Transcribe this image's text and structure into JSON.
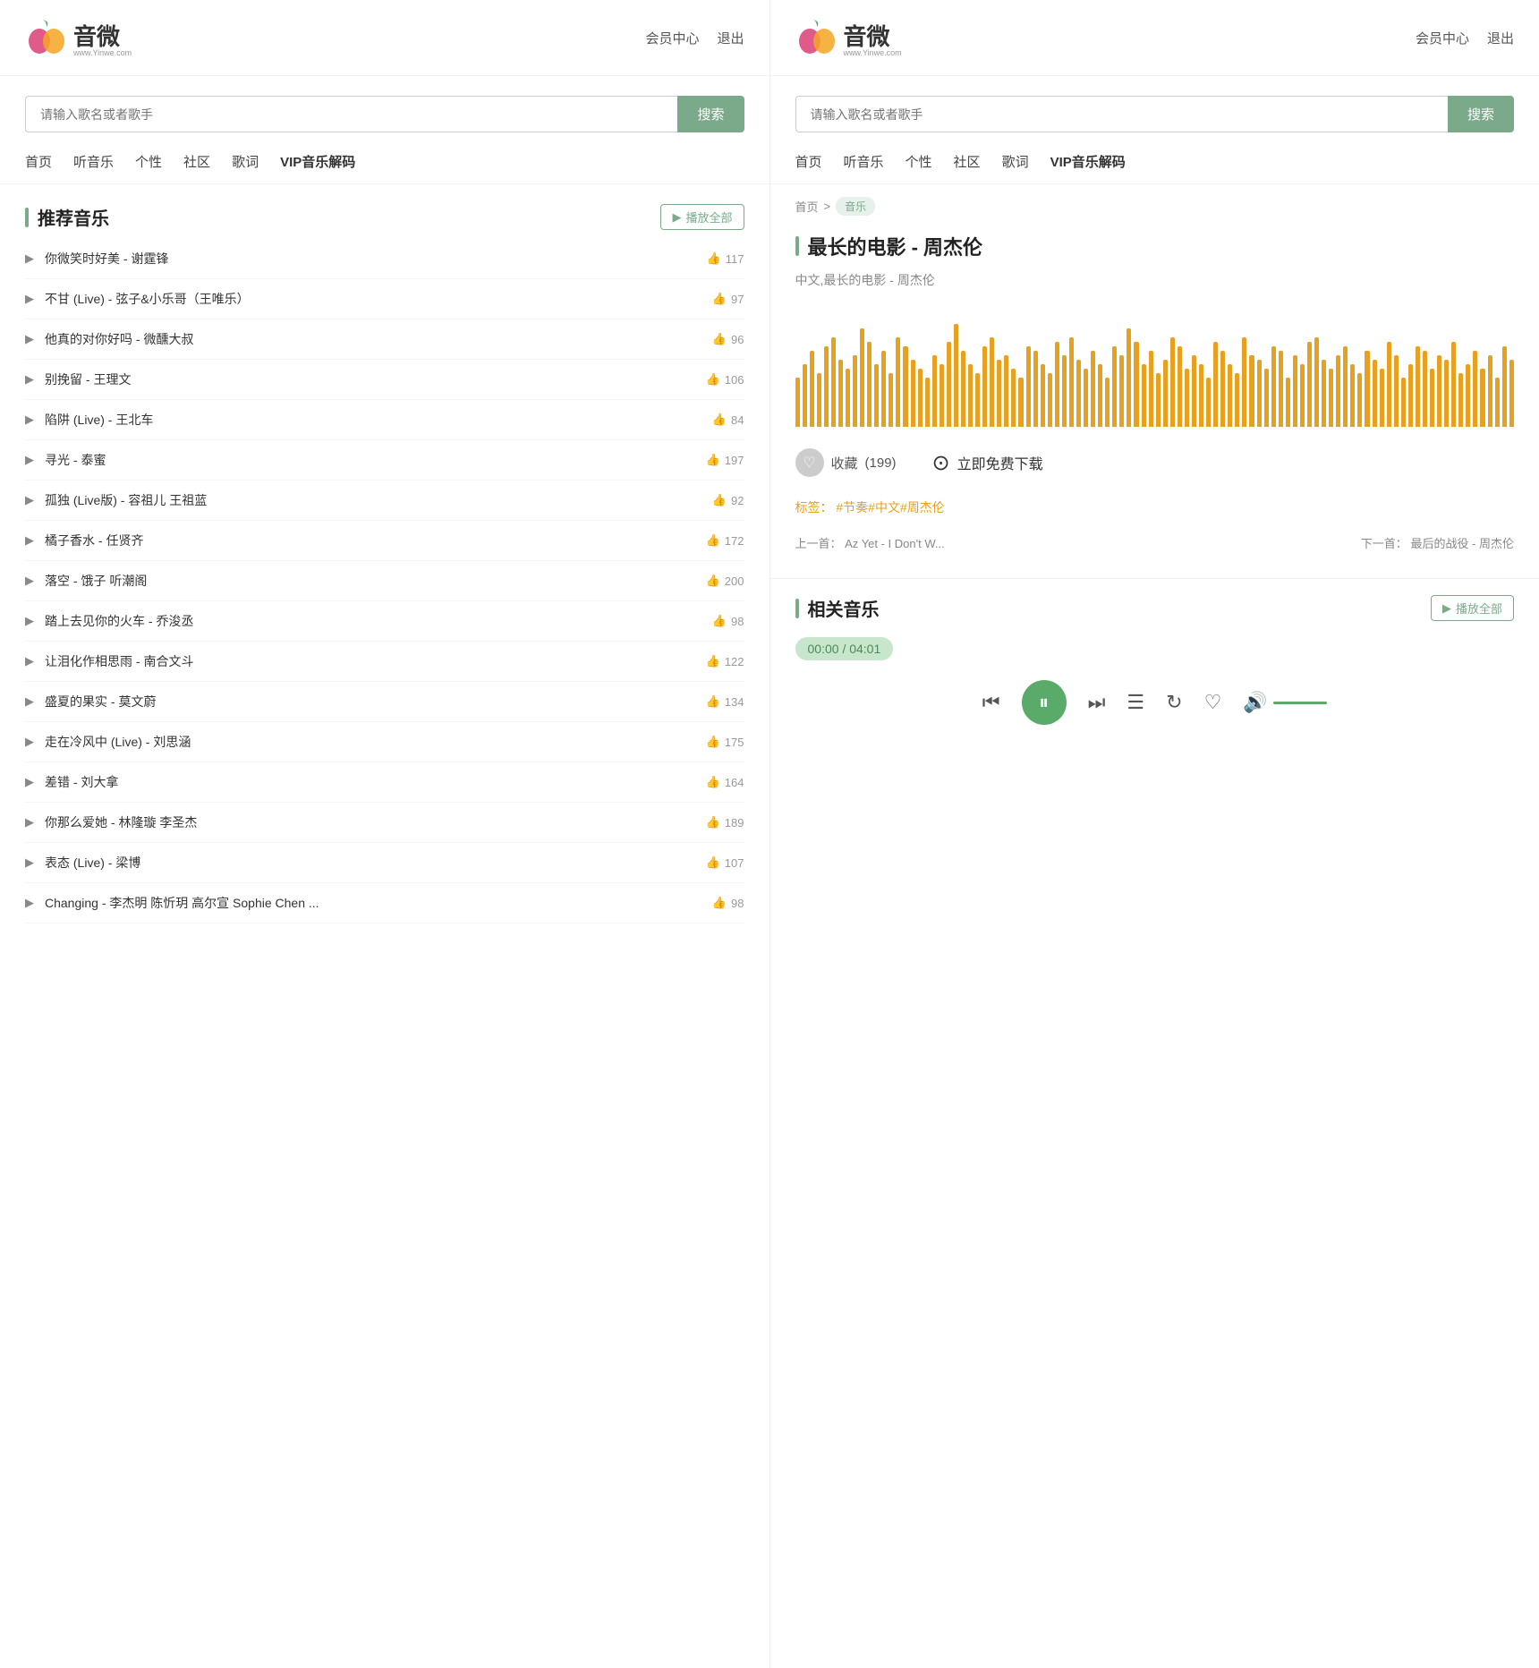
{
  "left_panel": {
    "logo": {
      "text": "音微",
      "sub": "www.Yinwe.com"
    },
    "header_nav": [
      "会员中心",
      "退出"
    ],
    "search": {
      "placeholder": "请输入歌名或者歌手",
      "btn": "搜索"
    },
    "nav_items": [
      "首页",
      "听音乐",
      "个性",
      "社区",
      "歌词",
      "VIP音乐解码"
    ],
    "section_title": "推荐音乐",
    "play_all": "播放全部",
    "songs": [
      {
        "name": "你微笑时好美 - 谢霆锋",
        "likes": 117
      },
      {
        "name": "不甘 (Live) - 弦子&小乐哥（王唯乐）",
        "likes": 97
      },
      {
        "name": "他真的对你好吗 - 微醺大叔",
        "likes": 96
      },
      {
        "name": "别挽留 - 王理文",
        "likes": 106
      },
      {
        "name": "陷阱 (Live) - 王北车",
        "likes": 84
      },
      {
        "name": "寻光 - 泰蜜",
        "likes": 197
      },
      {
        "name": "孤独 (Live版) - 容祖儿 王祖蓝",
        "likes": 92
      },
      {
        "name": "橘子香水 - 任贤齐",
        "likes": 172
      },
      {
        "name": "落空 - 饿子 听潮阁",
        "likes": 200
      },
      {
        "name": "踏上去见你的火车 - 乔浚丞",
        "likes": 98
      },
      {
        "name": "让泪化作相思雨 - 南合文斗",
        "likes": 122
      },
      {
        "name": "盛夏的果实 - 莫文蔚",
        "likes": 134
      },
      {
        "name": "走在冷风中 (Live) - 刘思涵",
        "likes": 175
      },
      {
        "name": "差错 - 刘大拿",
        "likes": 164
      },
      {
        "name": "你那么爱她 - 林隆璇 李圣杰",
        "likes": 189
      },
      {
        "name": "表态 (Live) - 梁博",
        "likes": 107
      },
      {
        "name": "Changing - 李杰明 陈忻玥 高尔宣 Sophie Chen ...",
        "likes": 98
      }
    ]
  },
  "right_panel": {
    "logo": {
      "text": "音微",
      "sub": "www.Yinwe.com"
    },
    "header_nav": [
      "会员中心",
      "退出"
    ],
    "search": {
      "placeholder": "请输入歌名或者歌手",
      "btn": "搜索"
    },
    "nav_items": [
      "首页",
      "听音乐",
      "个性",
      "社区",
      "歌词",
      "VIP音乐解码"
    ],
    "breadcrumb": {
      "home": "首页",
      "separator": ">",
      "tag": "音乐"
    },
    "song_title": "最长的电影 - 周杰伦",
    "song_subtitle": "中文,最长的电影 - 周杰伦",
    "collect_count": "(199)",
    "collect_label": "收藏",
    "download_label": "立即免费下载",
    "tags_label": "标签：",
    "tags": "#节奏#中文#周杰伦",
    "prev_label": "上一首：",
    "prev_song": "Az Yet - I Don't W...",
    "next_label": "下一首：",
    "next_song": "最后的战役 - 周杰伦",
    "related_section": "相关音乐",
    "play_all": "播放全部",
    "time_current": "00:00",
    "time_total": "04:01",
    "waveform_heights": [
      55,
      70,
      85,
      60,
      90,
      100,
      75,
      65,
      80,
      110,
      95,
      70,
      85,
      60,
      100,
      90,
      75,
      65,
      55,
      80,
      70,
      95,
      115,
      85,
      70,
      60,
      90,
      100,
      75,
      80,
      65,
      55,
      90,
      85,
      70,
      60,
      95,
      80,
      100,
      75,
      65,
      85,
      70,
      55,
      90,
      80,
      110,
      95,
      70,
      85,
      60,
      75,
      100,
      90,
      65,
      80,
      70,
      55,
      95,
      85,
      70,
      60,
      100,
      80,
      75,
      65,
      90,
      85,
      55,
      80,
      70,
      95,
      100,
      75,
      65,
      80,
      90,
      70,
      60,
      85,
      75,
      65,
      95,
      80,
      55,
      70,
      90,
      85,
      65,
      80,
      75,
      95,
      60,
      70,
      85,
      65,
      80,
      55,
      90,
      75
    ]
  }
}
